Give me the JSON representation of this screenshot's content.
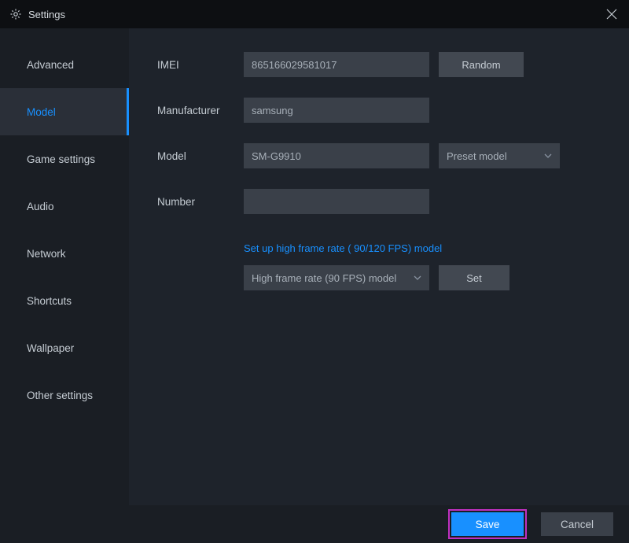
{
  "titlebar": {
    "title": "Settings"
  },
  "sidebar": {
    "items": [
      {
        "label": "Advanced",
        "active": false
      },
      {
        "label": "Model",
        "active": true
      },
      {
        "label": "Game settings",
        "active": false
      },
      {
        "label": "Audio",
        "active": false
      },
      {
        "label": "Network",
        "active": false
      },
      {
        "label": "Shortcuts",
        "active": false
      },
      {
        "label": "Wallpaper",
        "active": false
      },
      {
        "label": "Other settings",
        "active": false
      }
    ]
  },
  "form": {
    "imei_label": "IMEI",
    "imei_value": "865166029581017",
    "random_button": "Random",
    "manufacturer_label": "Manufacturer",
    "manufacturer_value": "samsung",
    "model_label": "Model",
    "model_value": "SM-G9910",
    "preset_label": "Preset model",
    "number_label": "Number",
    "number_value": "",
    "frame_link": "Set up high frame rate ( 90/120 FPS) model",
    "frame_select": "High frame rate (90 FPS) model",
    "set_button": "Set"
  },
  "footer": {
    "save": "Save",
    "cancel": "Cancel"
  }
}
